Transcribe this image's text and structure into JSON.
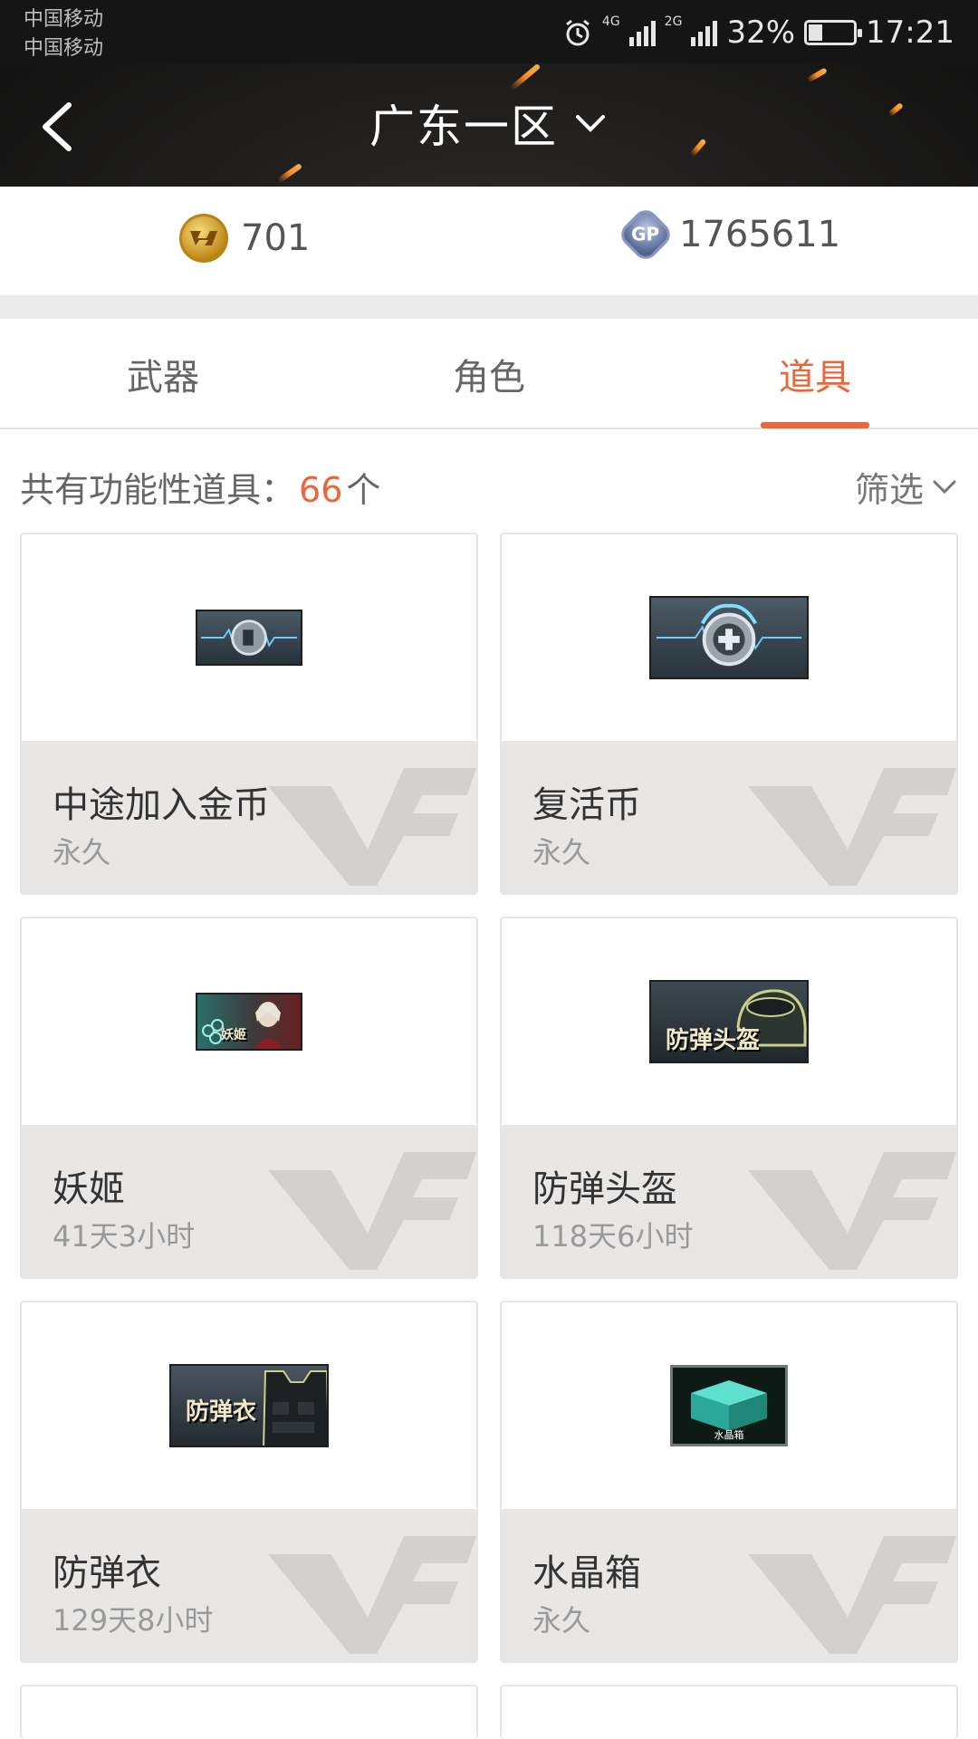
{
  "status_bar": {
    "carrier_1": "中国移动",
    "carrier_2": "中国移动",
    "net_1": "4G",
    "net_2": "2G",
    "battery": "32%",
    "battery_level": 0.32,
    "time": "17:21"
  },
  "header": {
    "title": "广东一区",
    "accent_color": "#e8683a"
  },
  "currency": {
    "cf_points": "701",
    "gp_points": "1765611",
    "gp_badge": "GP"
  },
  "tabs": [
    {
      "label": "武器",
      "active": false
    },
    {
      "label": "角色",
      "active": false
    },
    {
      "label": "道具",
      "active": true
    }
  ],
  "summary": {
    "prefix": "共有功能性道具：",
    "count": "66",
    "unit": "个",
    "filter_label": "筛选"
  },
  "items": [
    {
      "name": "中途加入金币",
      "duration": "永久",
      "icon": "join-coin-icon"
    },
    {
      "name": "复活币",
      "duration": "永久",
      "icon": "revive-coin-icon"
    },
    {
      "name": "妖姬",
      "duration": "41天3小时",
      "icon": "character-card-icon",
      "thumb_label": "妖姬"
    },
    {
      "name": "防弹头盔",
      "duration": "118天6小时",
      "icon": "helmet-icon",
      "thumb_label": "防弹头盔"
    },
    {
      "name": "防弹衣",
      "duration": "129天8小时",
      "icon": "vest-icon",
      "thumb_label": "防弹衣"
    },
    {
      "name": "水晶箱",
      "duration": "永久",
      "icon": "crystal-box-icon",
      "thumb_label": "水晶箱"
    }
  ]
}
